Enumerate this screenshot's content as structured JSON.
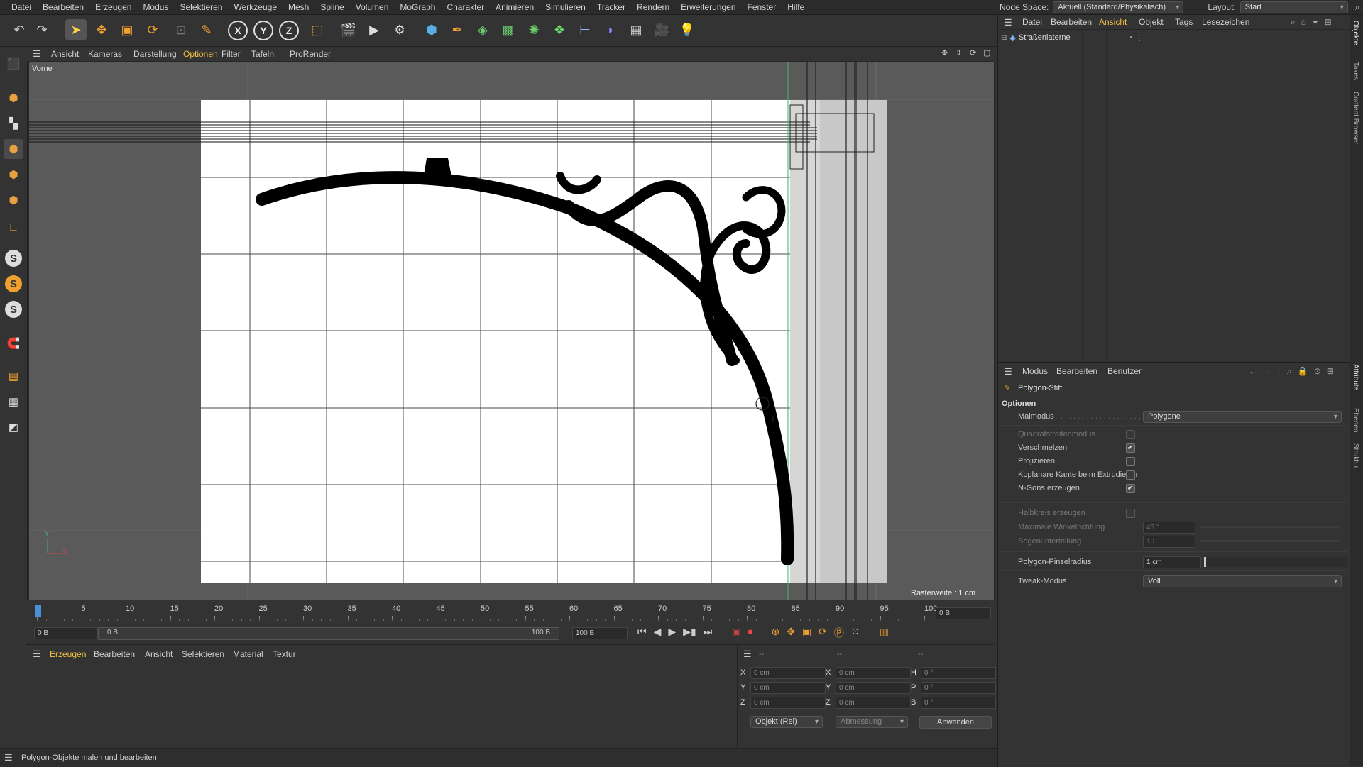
{
  "menubar": {
    "items": [
      "Datei",
      "Bearbeiten",
      "Erzeugen",
      "Modus",
      "Selektieren",
      "Werkzeuge",
      "Mesh",
      "Spline",
      "Volumen",
      "MoGraph",
      "Charakter",
      "Animieren",
      "Simulieren",
      "Tracker",
      "Rendern",
      "Erweiterungen",
      "Fenster",
      "Hilfe"
    ],
    "node_space_label": "Node Space:",
    "node_space_value": "Aktuell (Standard/Physikalisch)",
    "layout_label": "Layout:",
    "layout_value": "Start"
  },
  "toolbar": {
    "axis_x": "X",
    "axis_y": "Y",
    "axis_z": "Z"
  },
  "lefttb": {
    "s_label": "S"
  },
  "viewport": {
    "menu": [
      "Ansicht",
      "Kameras",
      "Darstellung",
      "Optionen",
      "Filter",
      "Tafeln",
      "ProRender"
    ],
    "active_menu": "Optionen",
    "view_name": "Vorne",
    "grid_info": "Rasterweite : 1 cm",
    "axis_y": "Y",
    "axis_x": "X"
  },
  "timeline": {
    "ticks": [
      "0",
      "5",
      "10",
      "15",
      "20",
      "25",
      "30",
      "35",
      "40",
      "45",
      "50",
      "55",
      "60",
      "65",
      "70",
      "75",
      "80",
      "85",
      "90",
      "95",
      "100"
    ],
    "current_frame": "0 B",
    "start_frame": "0 B",
    "range_start": "0 B",
    "range_end": "100 B",
    "end_frame": "100 B",
    "right_frame": "0 B"
  },
  "material": {
    "menu": [
      "Erzeugen",
      "Bearbeiten",
      "Ansicht",
      "Selektieren",
      "Material",
      "Textur"
    ]
  },
  "coords": {
    "col_headers": [
      "--",
      "--",
      "--"
    ],
    "rows": [
      {
        "a": "X",
        "av": "0 cm",
        "b": "X",
        "bv": "0 cm",
        "c": "H",
        "cv": "0 °"
      },
      {
        "a": "Y",
        "av": "0 cm",
        "b": "Y",
        "bv": "0 cm",
        "c": "P",
        "cv": "0 °"
      },
      {
        "a": "Z",
        "av": "0 cm",
        "b": "Z",
        "bv": "0 cm",
        "c": "B",
        "cv": "0 °"
      }
    ],
    "mode": "Objekt (Rel)",
    "size_mode": "Abmessung",
    "apply": "Anwenden"
  },
  "status": {
    "text": "Polygon-Objekte malen und bearbeiten"
  },
  "objects": {
    "menu": [
      "Datei",
      "Bearbeiten",
      "Ansicht",
      "Objekt",
      "Tags",
      "Lesezeichen"
    ],
    "active_menu": "Ansicht",
    "items": [
      {
        "name": "Straßenlaterne"
      }
    ]
  },
  "attributes": {
    "menu": [
      "Modus",
      "Bearbeiten",
      "Benutzer"
    ],
    "tool_name": "Polygon-Stift",
    "section": "Optionen",
    "paint_mode_label": "Malmodus",
    "paint_mode_value": "Polygone",
    "checks": [
      {
        "label": "Quadratstreifenmodus",
        "checked": false,
        "dim": true
      },
      {
        "label": "Verschmelzen",
        "checked": true,
        "dim": false
      },
      {
        "label": "Projizieren",
        "checked": false,
        "dim": false
      },
      {
        "label": "Koplanare Kante beim Extrudieren",
        "checked": false,
        "dim": false
      },
      {
        "label": "N-Gons erzeugen",
        "checked": true,
        "dim": false
      }
    ],
    "halfcircle_label": "Halbkreis erzeugen",
    "max_angle_label": "Maximale Winkelrichtung",
    "max_angle_value": "45 °",
    "arc_sub_label": "Bogenunterteilung",
    "arc_sub_value": "10",
    "brush_radius_label": "Polygon-Pinselradius",
    "brush_radius_value": "1 cm",
    "tweak_label": "Tweak-Modus",
    "tweak_value": "Voll"
  },
  "sidetabs": [
    "Objekte",
    "Takes",
    "Content Browser",
    "Attribute",
    "Ebenen",
    "Struktur"
  ]
}
